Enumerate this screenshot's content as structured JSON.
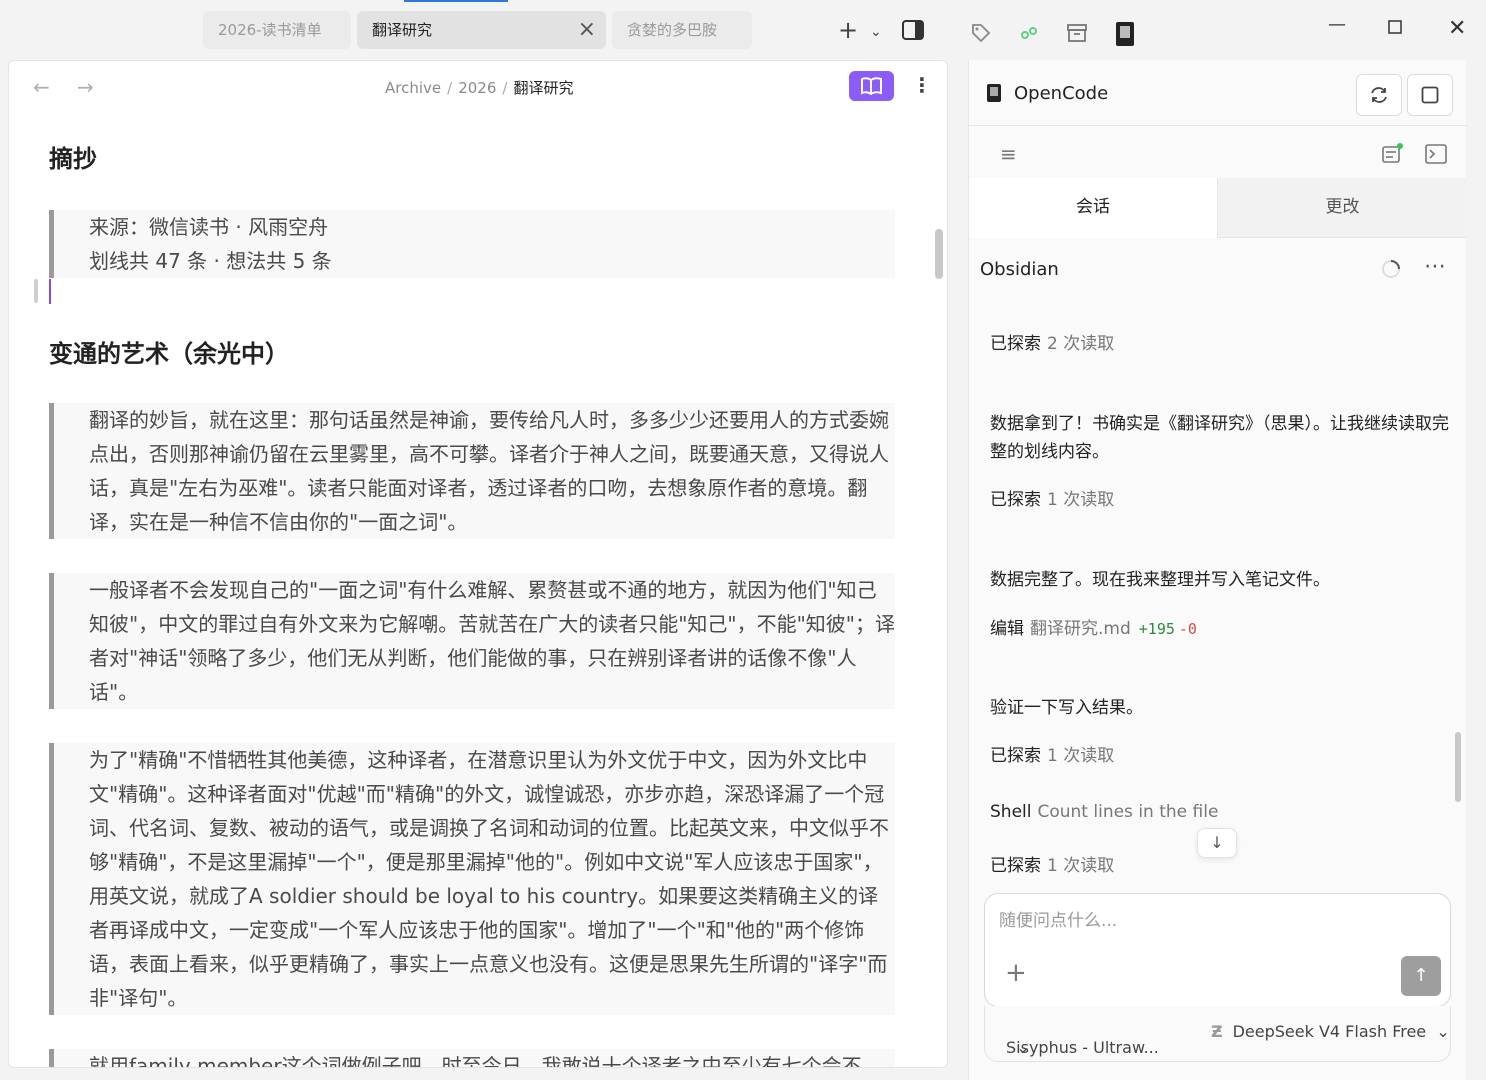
{
  "tabs": [
    {
      "label": "2026-读书清单"
    },
    {
      "label": "翻译研究"
    },
    {
      "label": "贪婪的多巴胺"
    }
  ],
  "breadcrumb": {
    "parts": [
      "Archive",
      "2026"
    ],
    "current": "翻译研究",
    "separator": "/"
  },
  "doc": {
    "heading1": "摘抄",
    "source_line1": "来源：微信读书 · 风雨空舟",
    "source_line2": "划线共 47 条 · 想法共 5 条",
    "heading2": "变通的艺术（余光中）",
    "quotes": [
      "翻译的妙旨，就在这里：那句话虽然是神谕，要传给凡人时，多多少少还要用人的方式委婉点出，否则那神谕仍留在云里雾里，高不可攀。译者介于神人之间，既要通天意，又得说人话，真是\"左右为巫难\"。读者只能面对译者，透过译者的口吻，去想象原作者的意境。翻译，实在是一种信不信由你的\"一面之词\"。",
      "一般译者不会发现自己的\"一面之词\"有什么难解、累赘甚或不通的地方，就因为他们\"知己知彼\"，中文的罪过自有外文来为它解嘲。苦就苦在广大的读者只能\"知己\"，不能\"知彼\"；译者对\"神话\"领略了多少，他们无从判断，他们能做的事，只在辨别译者讲的话像不像\"人话\"。",
      "为了\"精确\"不惜牺牲其他美德，这种译者，在潜意识里认为外文优于中文，因为外文比中文\"精确\"。这种译者面对\"优越\"而\"精确\"的外文，诚惶诚恐，亦步亦趋，深恐译漏了一个冠词、代名词、复数、被动的语气，或是调换了名词和动词的位置。比起英文来，中文似乎不够\"精确\"，不是这里漏掉\"一个\"，便是那里漏掉\"他的\"。例如中文说\"军人应该忠于国家\"，用英文说，就成了A soldier should be loyal to his country。如果要这类精确主义的译者再译成中文，一定变成\"一个军人应该忠于他的国家\"。增加了\"一个\"和\"他的\"两个修饰语，表面上看来，似乎更精确了，事实上一点意义也没有。这便是思果先生所谓的\"译字\"而非\"译句\"。",
      "就用family member这个词做例子吧，时至今日，我敢说十个译者之中至少有七个会不"
    ]
  },
  "panel": {
    "title": "OpenCode",
    "tab_session": "会话",
    "tab_changes": "更改",
    "session_name": "Obsidian",
    "messages": {
      "m1_label": "已探索",
      "m1_detail": "2 次读取",
      "m2_text": "数据拿到了！书确实是《翻译研究》（思果）。让我继续读取完整的划线内容。",
      "m3_label": "已探索",
      "m3_detail": "1 次读取",
      "m4_text": "数据完整了。现在我来整理并写入笔记文件。",
      "m5_label": "编辑",
      "m5_file": "翻译研究.md",
      "m5_add": "+195",
      "m5_del": "-0",
      "m6_text": "验证一下写入结果。",
      "m7_label": "已探索",
      "m7_detail": "1 次读取",
      "m8_label": "Shell",
      "m8_detail": "Count lines in the file",
      "m9_label": "已探索",
      "m9_detail": "1 次读取"
    },
    "input_placeholder": "随便问点什么...",
    "agent": "Sisyphus - Ultraw...",
    "model": "DeepSeek V4 Flash Free"
  }
}
